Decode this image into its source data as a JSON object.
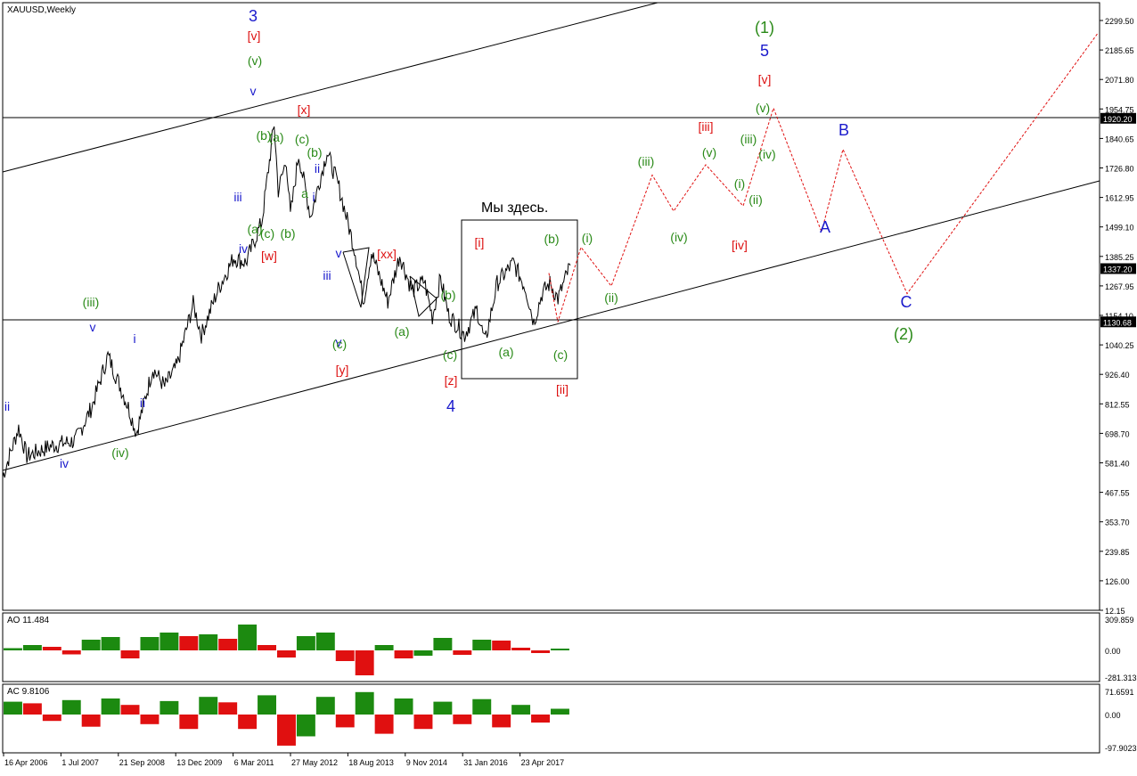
{
  "symbol_label": "XAUUSD,Weekly",
  "colors": {
    "background": "#ffffff",
    "price": "#000000",
    "wave_blue": "#1a1acc",
    "wave_red": "#dd1111",
    "wave_green": "#2a8a18",
    "forecast": "#e01010",
    "osc_up": "#1c8a10",
    "osc_down": "#e01010"
  },
  "axis": {
    "main_ticks": [
      "2299.50",
      "2185.65",
      "2071.80",
      "1954.75",
      "1840.65",
      "1726.80",
      "1612.95",
      "1499.10",
      "1385.25",
      "1267.95",
      "1154.10",
      "1040.25",
      "926.40",
      "812.55",
      "698.70",
      "581.40",
      "467.55",
      "353.70",
      "239.85",
      "126.00",
      "12.15"
    ],
    "date_ticks": [
      "16 Apr 2006",
      "1 Jul 2007",
      "21 Sep 2008",
      "13 Dec 2009",
      "6 Mar 2011",
      "27 May 2012",
      "18 Aug 2013",
      "9 Nov 2014",
      "31 Jan 2016",
      "23 Apr 2017"
    ],
    "price_markers": [
      {
        "label": "1920.20",
        "value": 1920.2
      },
      {
        "label": "1337.20",
        "value": 1337.2
      },
      {
        "label": "1130.68",
        "value": 1130.68
      }
    ]
  },
  "ao_panel": {
    "label": "AO 11.484",
    "ticks": [
      "309.859",
      "0.00",
      "-281.313"
    ]
  },
  "ac_panel": {
    "label": "AC 9.8106",
    "ticks": [
      "71.6591",
      "0.00",
      "-97.9023"
    ]
  },
  "annotation": "Мы здесь.",
  "wave_labels": [
    {
      "text": "3",
      "color": "blue",
      "big": true
    },
    {
      "text": "[v]",
      "color": "red"
    },
    {
      "text": "(v)",
      "color": "green"
    },
    {
      "text": "v",
      "color": "blue"
    },
    {
      "text": "[x]",
      "color": "red"
    },
    {
      "text": "(b)",
      "color": "green"
    },
    {
      "text": "(a)",
      "color": "green"
    },
    {
      "text": "(c)",
      "color": "green"
    },
    {
      "text": "(b)",
      "color": "green"
    },
    {
      "text": "ii",
      "color": "blue"
    },
    {
      "text": "a",
      "color": "green"
    },
    {
      "text": "i",
      "color": "blue"
    },
    {
      "text": "iii",
      "color": "blue"
    },
    {
      "text": "(a)",
      "color": "green"
    },
    {
      "text": "(c)",
      "color": "green"
    },
    {
      "text": "(b)",
      "color": "green"
    },
    {
      "text": "iv",
      "color": "blue"
    },
    {
      "text": "[w]",
      "color": "red"
    },
    {
      "text": "v",
      "color": "blue"
    },
    {
      "text": "iii",
      "color": "blue"
    },
    {
      "text": "v",
      "color": "blue"
    },
    {
      "text": "(c)",
      "color": "green"
    },
    {
      "text": "[y]",
      "color": "red"
    },
    {
      "text": "[xx]",
      "color": "red"
    },
    {
      "text": "(a)",
      "color": "green"
    },
    {
      "text": "(b)",
      "color": "green"
    },
    {
      "text": "(c)",
      "color": "green"
    },
    {
      "text": "[z]",
      "color": "red"
    },
    {
      "text": "4",
      "color": "blue",
      "big": true
    },
    {
      "text": "[i]",
      "color": "red"
    },
    {
      "text": "(a)",
      "color": "green"
    },
    {
      "text": "(b)",
      "color": "green"
    },
    {
      "text": "(c)",
      "color": "green"
    },
    {
      "text": "[ii]",
      "color": "red"
    },
    {
      "text": "(i)",
      "color": "green"
    },
    {
      "text": "(ii)",
      "color": "green"
    },
    {
      "text": "(iii)",
      "color": "green"
    },
    {
      "text": "(iv)",
      "color": "green"
    },
    {
      "text": "(v)",
      "color": "green"
    },
    {
      "text": "[iii]",
      "color": "red"
    },
    {
      "text": "[iv]",
      "color": "red"
    },
    {
      "text": "(i)",
      "color": "green"
    },
    {
      "text": "(ii)",
      "color": "green"
    },
    {
      "text": "(iii)",
      "color": "green"
    },
    {
      "text": "(iv)",
      "color": "green"
    },
    {
      "text": "(v)",
      "color": "green"
    },
    {
      "text": "[v]",
      "color": "red"
    },
    {
      "text": "5",
      "color": "blue",
      "big": true
    },
    {
      "text": "(1)",
      "color": "green",
      "big": true
    },
    {
      "text": "A",
      "color": "blue",
      "big": true
    },
    {
      "text": "B",
      "color": "blue",
      "big": true
    },
    {
      "text": "C",
      "color": "blue",
      "big": true
    },
    {
      "text": "(2)",
      "color": "green",
      "big": true
    },
    {
      "text": "ii",
      "color": "blue"
    },
    {
      "text": "iv",
      "color": "blue"
    },
    {
      "text": "(iii)",
      "color": "green"
    },
    {
      "text": "v",
      "color": "blue"
    },
    {
      "text": "i",
      "color": "blue"
    },
    {
      "text": "ii",
      "color": "blue"
    },
    {
      "text": "(iv)",
      "color": "green"
    }
  ],
  "chart_data": {
    "type": "line",
    "title": "",
    "x": [
      "2006-01",
      "2006-05",
      "2006-07",
      "2007-01",
      "2007-07",
      "2007-11",
      "2008-03",
      "2008-08",
      "2008-10",
      "2009-02",
      "2009-05",
      "2009-08",
      "2009-12",
      "2010-02",
      "2010-06",
      "2010-10",
      "2011-01",
      "2011-05",
      "2011-08",
      "2011-09",
      "2011-11",
      "2011-12",
      "2012-02",
      "2012-05",
      "2012-09",
      "2012-12",
      "2013-04",
      "2013-06",
      "2013-08",
      "2013-12",
      "2014-03",
      "2014-06",
      "2014-09",
      "2014-11",
      "2015-01",
      "2015-03",
      "2015-07",
      "2015-10",
      "2015-12",
      "2016-03",
      "2016-07",
      "2016-10",
      "2016-12",
      "2017-02",
      "2017-04",
      "2017-06",
      "2017-09"
    ],
    "series": [
      {
        "values": [
          530,
          720,
          610,
          650,
          670,
          800,
          1000,
          800,
          700,
          950,
          880,
          960,
          1200,
          1080,
          1250,
          1380,
          1360,
          1520,
          1900,
          1640,
          1760,
          1540,
          1780,
          1540,
          1790,
          1650,
          1400,
          1210,
          1400,
          1210,
          1390,
          1250,
          1290,
          1150,
          1300,
          1160,
          1080,
          1180,
          1050,
          1280,
          1360,
          1260,
          1130,
          1240,
          1280,
          1220,
          1350
        ]
      }
    ],
    "forecast_values": [
      1320,
      1130,
      1420,
      1270,
      1700,
      1560,
      1740,
      1580,
      1960,
      1480,
      1800,
      1240,
      2250
    ],
    "ylim": [
      12.15,
      2360
    ],
    "ao": [
      25,
      60,
      40,
      -45,
      120,
      150,
      -90,
      150,
      200,
      160,
      180,
      130,
      290,
      60,
      -80,
      160,
      200,
      -120,
      -280,
      60,
      -90,
      -60,
      140,
      -50,
      120,
      110,
      30,
      -30,
      20
    ],
    "ac": [
      40,
      35,
      -20,
      45,
      -38,
      50,
      30,
      -30,
      42,
      -45,
      55,
      38,
      -45,
      60,
      -97,
      -68,
      55,
      -40,
      70,
      -60,
      50,
      -45,
      40,
      -30,
      48,
      -40,
      30,
      -25,
      18
    ]
  }
}
